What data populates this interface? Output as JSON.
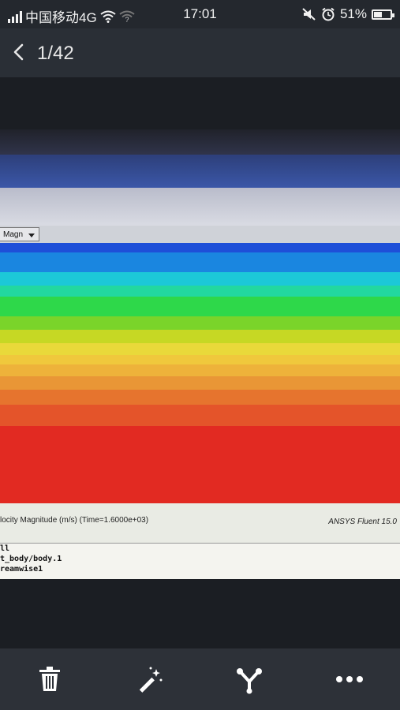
{
  "status_bar": {
    "carrier": "中国移动4G",
    "time": "17:01",
    "battery": "51%",
    "battery_level": 0.51
  },
  "header": {
    "counter": "1/42"
  },
  "photo": {
    "dropdown_label": "Magn",
    "caption_label": "locity Magnitude (m/s)  (Time=1.6000e+03)",
    "caption_brand": "ANSYS Fluent 15.0",
    "console_lines": [
      "ll",
      "t_body/body.1",
      "reamwise1"
    ],
    "contour_colors": [
      "#1e4fd8",
      "#1a86e0",
      "#1cc8d8",
      "#22d8a0",
      "#2ed84a",
      "#7ad42a",
      "#c6d824",
      "#e9d93a",
      "#f0c83c",
      "#eeb23a",
      "#e99636",
      "#e6742e",
      "#e4542a",
      "#e22a22"
    ]
  },
  "toolbar": {
    "icons": [
      "trash-icon",
      "magic-wand-icon",
      "share-icon",
      "more-icon"
    ]
  }
}
